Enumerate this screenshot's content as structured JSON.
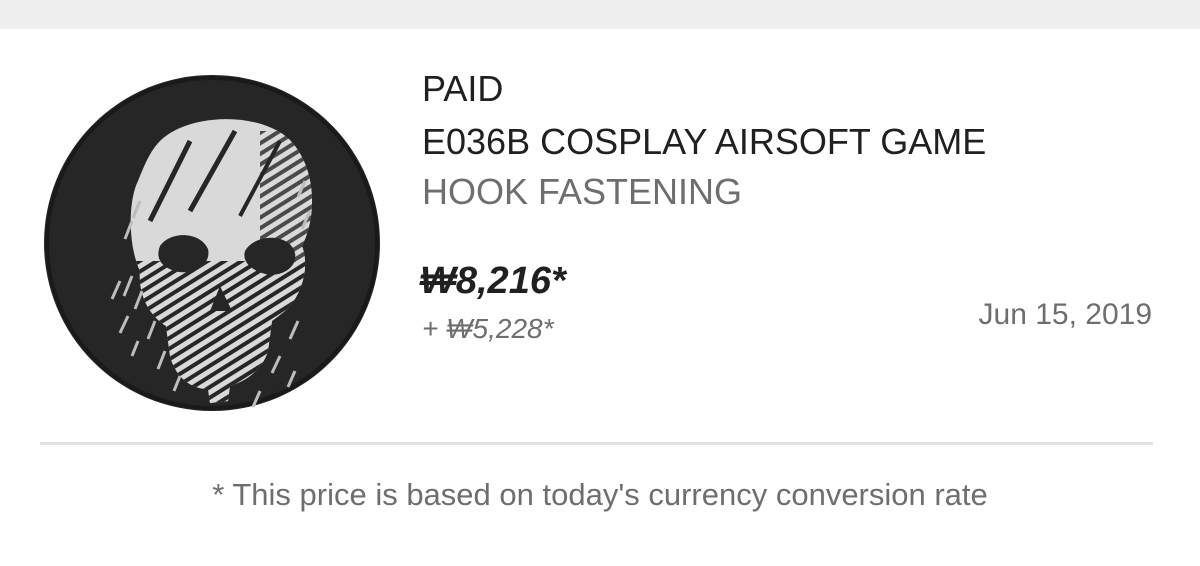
{
  "order": {
    "status": "PAID",
    "title": "E036B COSPLAY AIRSOFT GAME",
    "subtitle": "HOOK FASTENING",
    "price": "₩8,216*",
    "shipping": "+ ₩5,228*",
    "date": "Jun 15, 2019",
    "thumbnail_icon": "skull-patch-icon"
  },
  "footnote": "* This price is based on today's currency conversion rate",
  "colors": {
    "background": "#ffffff",
    "top_strip": "#eeeeee",
    "primary_text": "#202020",
    "secondary_text": "#6e6e6e",
    "divider": "#e2e2e2",
    "patch_dark": "#262626",
    "patch_light": "#d9d9d9"
  }
}
